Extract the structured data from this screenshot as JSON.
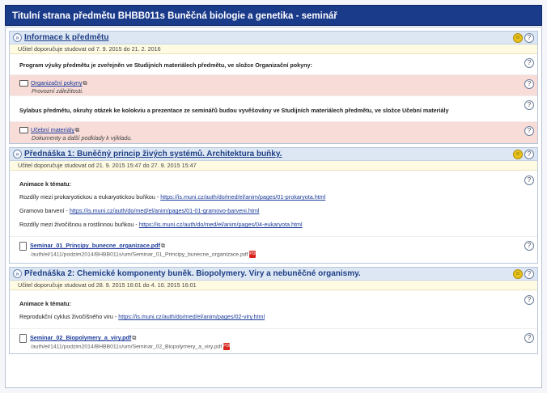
{
  "window": {
    "title": "Titulní strana předmětu BHBB011s Buněčná biologie a genetika - seminář"
  },
  "sections": [
    {
      "title": "Informace k předmětu",
      "date": "Učitel doporučuje studovat od 7. 9. 2015 do 21. 2. 2016",
      "text1": "Program výuky předmětu je zveřejněn ve Studijních materiálech předmětu, ve složce Organizační pokyny:",
      "folder1_link": "Organizační pokyny",
      "folder1_sub": "Provozní záležitosti.",
      "text2": "Sylabus předmětu, okruhy otázek ke kolokviu a prezentace ze seminářů budou vyvěšovány ve Studijních materiálech předmětu, ve složce Učební materiály",
      "folder2_link": "Učební materiály",
      "folder2_sub": "Dokumenty a další podklady k výkladu."
    },
    {
      "title": "Přednáška 1: Buněčný princip živých systémů. Architektura buňky.",
      "date": "Učitel doporučuje studovat od 21. 9. 2015 15:47 do 27. 9. 2015 15:47",
      "heading": "Animace k tématu:",
      "line1_text": "Rozdíly mezi prokaryotickou a eukaryotickou buňkou - ",
      "line1_link": "https://is.muni.cz/auth/do/med/el/anim/pages/01-prokaryota.html",
      "line2_text": "Gramovo barvení - ",
      "line2_link": "https://is.muni.cz/auth/do/med/el/anim/pages/01-01-gramovo-barveni.html",
      "line3_text": "Rozdíly mezi živočišnou a rostlinnou buňkou - ",
      "line3_link": "https://is.muni.cz/auth/do/med/el/anim/pages/04-eukaryota.html",
      "file_link": "Seminar_01_Principy_bunecne_organizace.pdf",
      "file_path": "/auth/el/1411/podzim2014/BHBB011s/um/Seminar_01_Principy_bunecne_organizace.pdf"
    },
    {
      "title": "Přednáška 2: Chemické komponenty buněk. Biopolymery. Viry a nebuněčné organismy.",
      "date": "Učitel doporučuje studovat od 28. 9. 2015 16:01 do 4. 10. 2015 16:01",
      "heading": "Animace k tématu:",
      "line1_text": "Reprodukční cyklus živočišného viru - ",
      "line1_link": "https://is.muni.cz/auth/do/med/el/anim/pages/02-viry.html",
      "file_link": "Seminar_02_Biopolymery_a_viry.pdf",
      "file_path": "/auth/el/1411/podzim2014/BHBB011s/um/Seminar_02_Biopolymery_a_viry.pdf"
    }
  ],
  "icons": {
    "toggle": "collapse-toggle-icon",
    "sun": "status-icon",
    "help": "help-icon",
    "folder": "folder-icon",
    "file": "file-icon",
    "pdf": "pdf-icon"
  },
  "colors": {
    "titlebar": "#1a3a8a",
    "section_head": "#dde7f4",
    "date_row": "#fffbe2",
    "pink_row": "#f7dcd7",
    "link": "#1a3a9a"
  }
}
